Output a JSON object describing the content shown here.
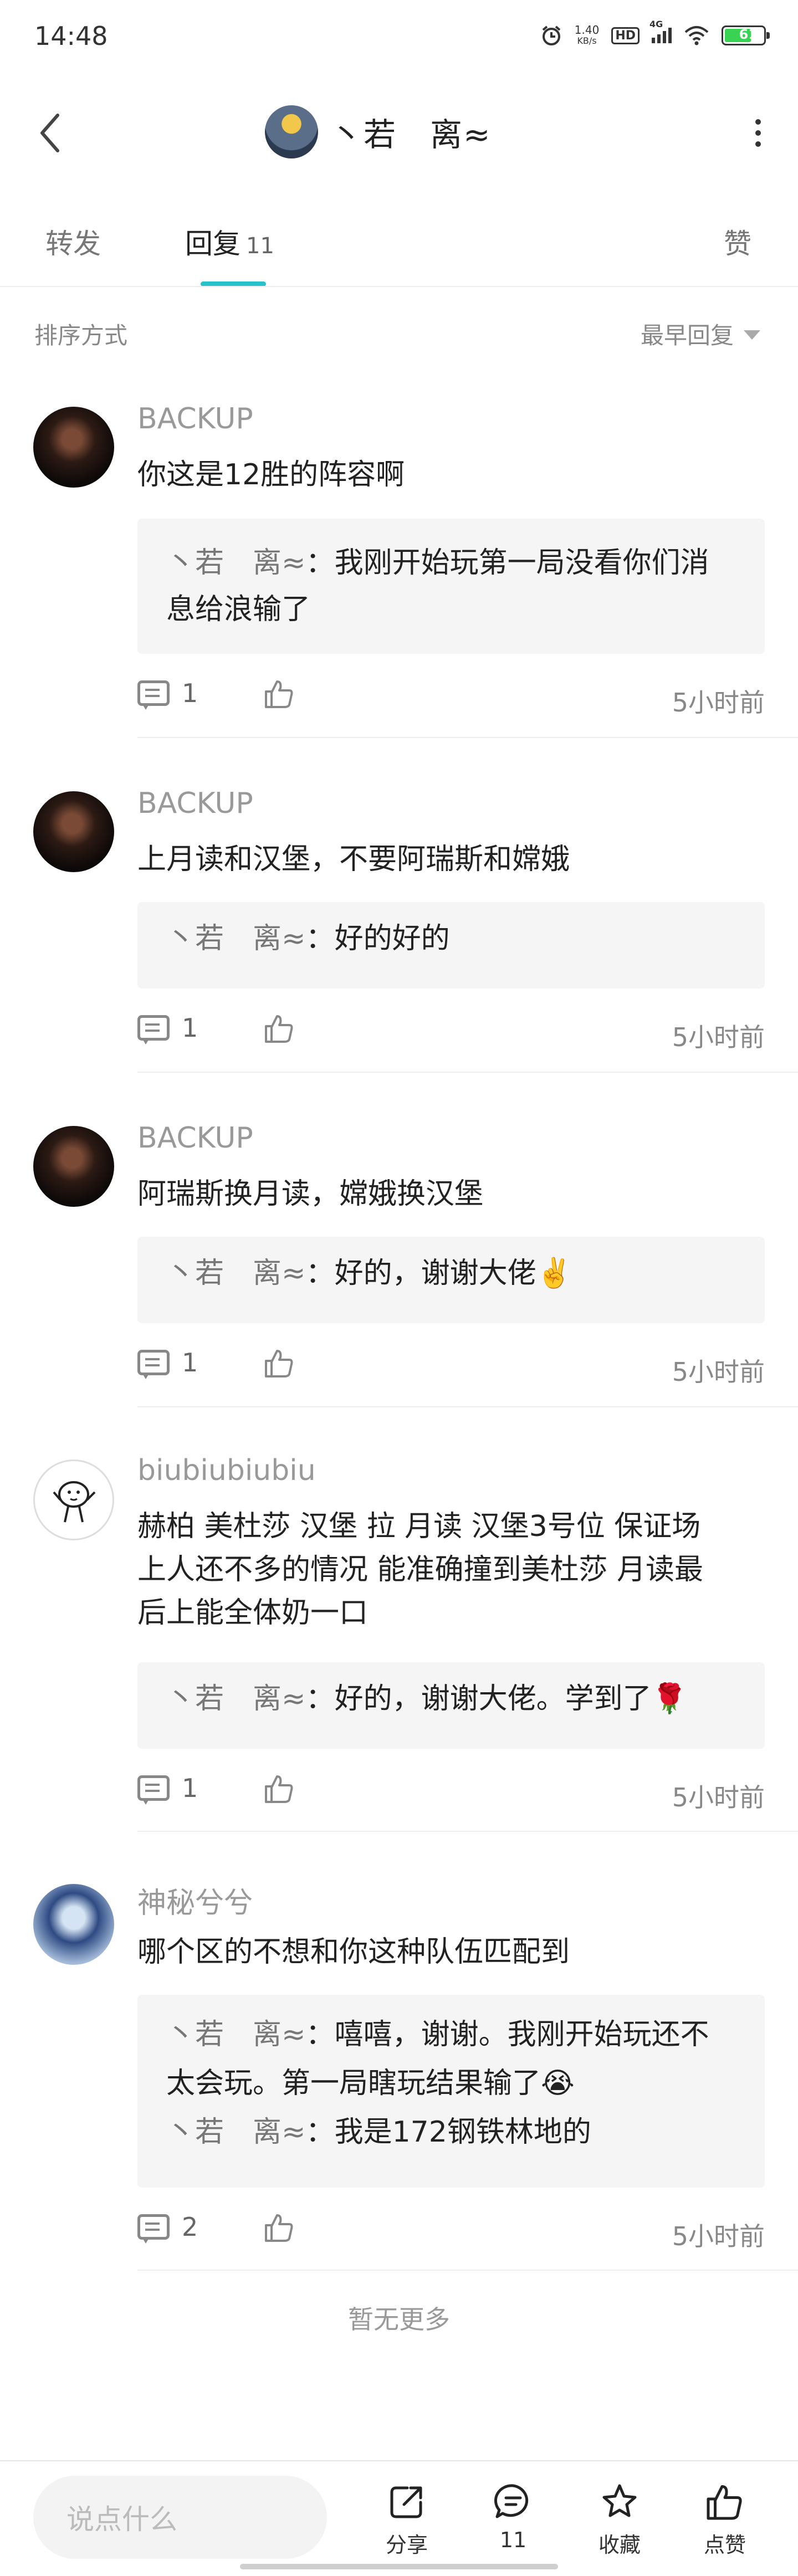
{
  "status_bar": {
    "time": "14:48",
    "net_speed_value": "1.40",
    "net_speed_unit": "KB/s",
    "hd": "HD",
    "network": "4G",
    "battery": "61"
  },
  "header": {
    "title": "丶若　离≈"
  },
  "tabs": [
    {
      "label": "转发"
    },
    {
      "label": "回复",
      "count": "11"
    },
    {
      "label": "赞"
    }
  ],
  "sort": {
    "label": "排序方式",
    "value": "最早回复"
  },
  "comments": [
    {
      "user": "BACKUP",
      "text": "你这是12胜的阵容啊",
      "replies": [
        {
          "user": "丶若　离≈",
          "text": "：我刚开始玩第一局没看你们消",
          "cont": "息给浪输了"
        }
      ],
      "reply_count": "1",
      "time": "5小时前"
    },
    {
      "user": "BACKUP",
      "text": "上月读和汉堡，不要阿瑞斯和嫦娥",
      "replies": [
        {
          "user": "丶若　离≈",
          "text": "：好的好的"
        }
      ],
      "reply_count": "1",
      "time": "5小时前"
    },
    {
      "user": "BACKUP",
      "text": "阿瑞斯换月读，嫦娥换汉堡",
      "replies": [
        {
          "user": "丶若　离≈",
          "text": "：好的，谢谢大佬✌️"
        }
      ],
      "reply_count": "1",
      "time": "5小时前"
    },
    {
      "user": "biubiubiubiu",
      "text_lines": [
        "赫柏 美杜莎  汉堡 拉 月读  汉堡3号位 保证场",
        "上人还不多的情况 能准确撞到美杜莎   月读最",
        "后上能全体奶一口"
      ],
      "replies": [
        {
          "user": "丶若　离≈",
          "text": "：好的，谢谢大佬。学到了🌹"
        }
      ],
      "reply_count": "1",
      "time": "5小时前"
    },
    {
      "user": "神秘兮兮",
      "text": "哪个区的不想和你这种队伍匹配到",
      "replies": [
        {
          "user": "丶若　离≈",
          "text": "：嘻嘻，谢谢。我刚开始玩还不",
          "cont": "太会玩。第一局瞎玩结果输了😭"
        },
        {
          "user": "丶若　离≈",
          "text": "：我是172钢铁林地的"
        }
      ],
      "reply_count": "2",
      "time": "5小时前"
    }
  ],
  "no_more": "暂无更多",
  "bottom_bar": {
    "input_placeholder": "说点什么",
    "share_label": "分享",
    "comment_count": "11",
    "favorite_label": "收藏",
    "like_label": "点赞"
  }
}
